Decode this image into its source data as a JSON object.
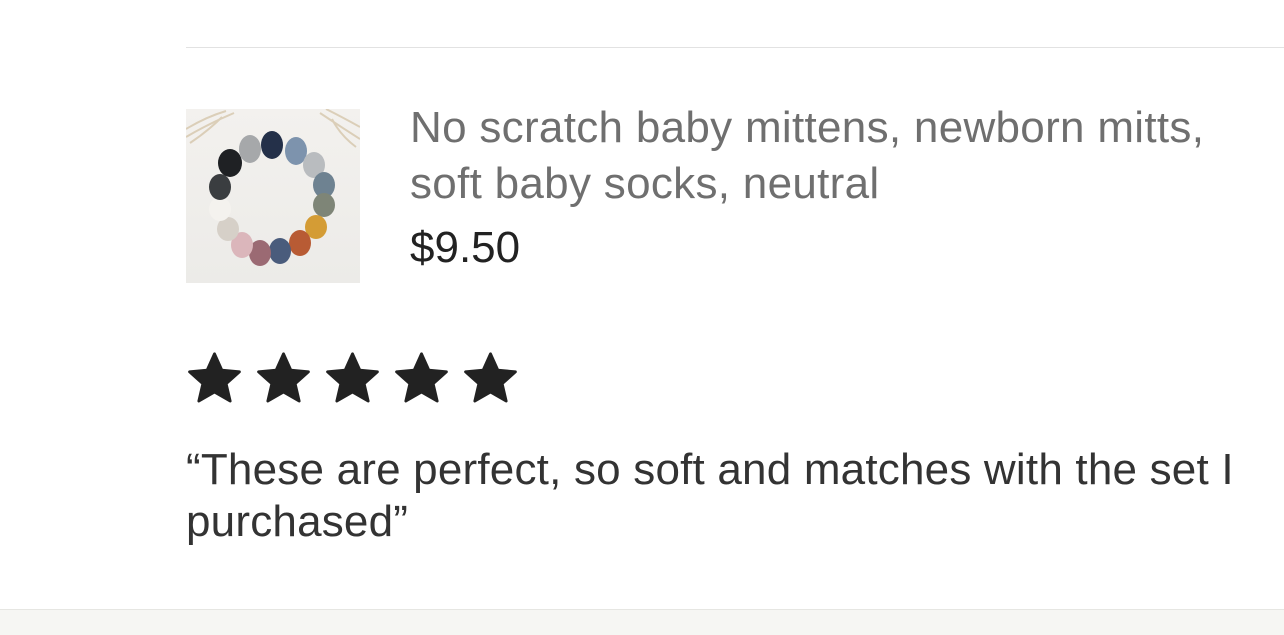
{
  "listing": {
    "title": "No scratch baby mittens, newborn mitts, soft baby socks, neutral",
    "price": "$9.50",
    "thumbnail_icon": "product-photo-mittens-circle"
  },
  "review": {
    "rating": 5,
    "rating_max": 5,
    "star_color": "#222222",
    "text": "“These are perfect, so soft and matches with the set I purchased”"
  }
}
